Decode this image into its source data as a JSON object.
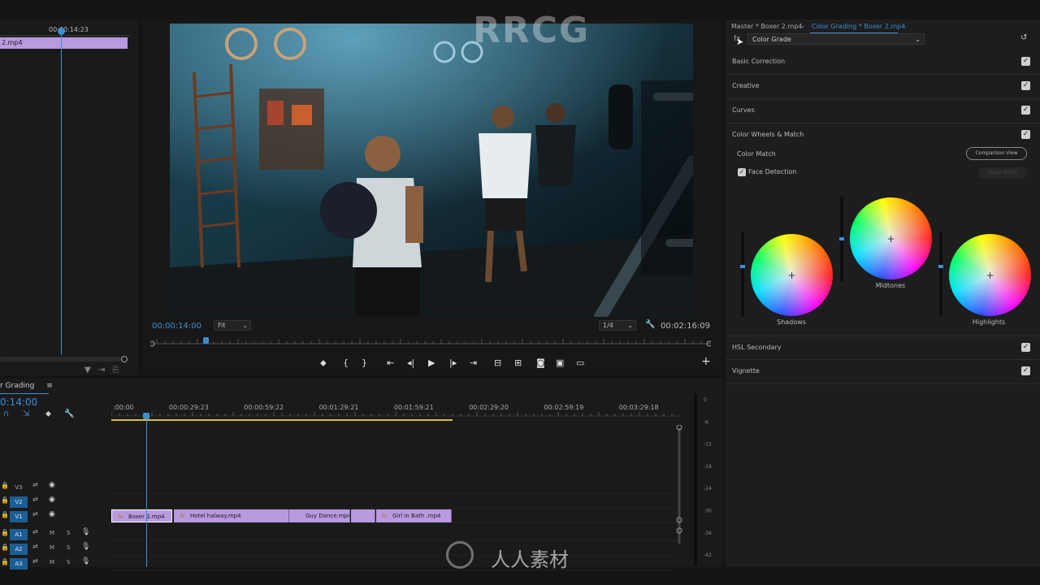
{
  "source": {
    "timecode": "00:00:14:23",
    "clip_label": "2.mp4"
  },
  "program": {
    "timecode": "00:00:14:00",
    "fit": "Fit",
    "resolution": "1/4",
    "duration": "00:02:16:09"
  },
  "timeline": {
    "title": "r Grading",
    "timecode": "0:14:00",
    "ruler_labels": [
      ":00:00",
      "00:00:29:23",
      "00:00:59:22",
      "00:01:29:21",
      "00:01:59:21",
      "00:02:29:20",
      "00:02:59:19",
      "00:03:29:18"
    ],
    "tracks": [
      {
        "label": "V3",
        "type": "video"
      },
      {
        "label": "V2",
        "type": "video"
      },
      {
        "label": "V1",
        "type": "video"
      },
      {
        "label": "A1",
        "type": "audio"
      },
      {
        "label": "A2",
        "type": "audio"
      },
      {
        "label": "A3",
        "type": "audio"
      }
    ],
    "mute_label": "M",
    "solo_label": "S",
    "clips": [
      {
        "label": "Boxer 2.mp4",
        "fx": "fx"
      },
      {
        "label": "Hotel halway.mp4",
        "fx": "fx"
      },
      {
        "label": "Guy Dance.mp4",
        "fx": ""
      },
      {
        "label": "",
        "fx": ""
      },
      {
        "label": "Girl in Bath .mp4",
        "fx": "fx"
      }
    ],
    "meter_labels": [
      "0",
      "-6",
      "-12",
      "-18",
      "-24",
      "-30",
      "-36",
      "-42"
    ]
  },
  "lumetri": {
    "tab_master": "Master * Boxer 2.mp4",
    "tab_active": "Color Grading * Boxer 2.mp4",
    "preset": "Color Grade",
    "sections": [
      {
        "label": "Basic Correction"
      },
      {
        "label": "Creative"
      },
      {
        "label": "Curves"
      },
      {
        "label": "Color Wheels & Match"
      }
    ],
    "color_match_label": "Color Match",
    "comparison_view_label": "Comparison View",
    "face_detection_label": "Face Detection",
    "apply_match_label": "Apply Match",
    "wheels": [
      {
        "label": "Shadows",
        "level": 0.6
      },
      {
        "label": "Midtones",
        "level": 0.5
      },
      {
        "label": "Highlights",
        "level": 0.6
      }
    ],
    "lower_sections": [
      {
        "label": "HSL Secondary"
      },
      {
        "label": "Vignette"
      }
    ]
  },
  "watermark": {
    "top": "RRCG",
    "bottom": "人人素材"
  },
  "colors": {
    "accent": "#3a8fd6",
    "clip": "#b99ae0",
    "work_area": "#d8c33a"
  }
}
